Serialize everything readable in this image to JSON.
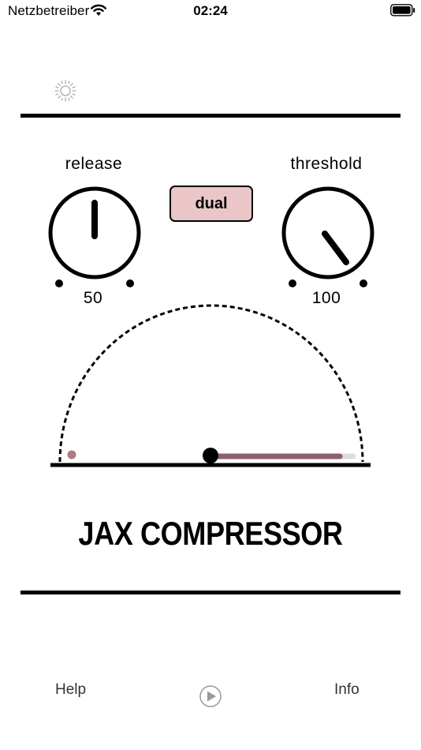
{
  "status_bar": {
    "carrier": "Netzbetreiber",
    "time": "02:24"
  },
  "icons": {
    "brightness": "sun-icon",
    "play": "play-icon",
    "wifi": "wifi-icon",
    "battery": "battery-icon"
  },
  "controls": {
    "release": {
      "label": "release",
      "value": "50"
    },
    "threshold": {
      "label": "threshold",
      "value": "100"
    },
    "mode_button": "dual"
  },
  "meter": {
    "level_fraction": 0.54,
    "bar_color": "#8e5f6e",
    "track_color": "#dddddd",
    "marker_color": "#b07a82"
  },
  "app_title": "JAX COMPRESSOR",
  "footer": {
    "help": "Help",
    "info": "Info"
  },
  "colors": {
    "accent_button": "#ebc6c8",
    "foreground": "#000000"
  }
}
